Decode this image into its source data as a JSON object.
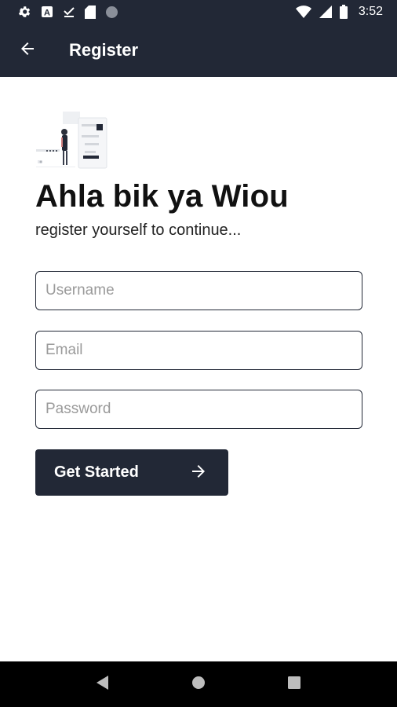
{
  "status_bar": {
    "time": "3:52",
    "left_icons": [
      "settings-icon",
      "a-icon",
      "download-done-icon",
      "sd-card-icon",
      "circle-icon"
    ],
    "right_icons": [
      "wifi-icon",
      "signal-icon",
      "battery-icon"
    ]
  },
  "app_bar": {
    "title": "Register",
    "back_icon": "arrow-back-icon"
  },
  "header": {
    "greeting": "Ahla bik ya Wiou",
    "subtitle": "register yourself to continue..."
  },
  "form": {
    "username_placeholder": "Username",
    "email_placeholder": "Email",
    "password_placeholder": "Password",
    "username_value": "",
    "email_value": "",
    "password_value": ""
  },
  "cta": {
    "label": "Get Started",
    "icon": "arrow-forward-icon"
  },
  "nav_bar": {
    "buttons": [
      "back-triangle-icon",
      "home-circle-icon",
      "recents-square-icon"
    ]
  },
  "colors": {
    "primary": "#222836",
    "background": "#ffffff",
    "nav": "#000000"
  }
}
